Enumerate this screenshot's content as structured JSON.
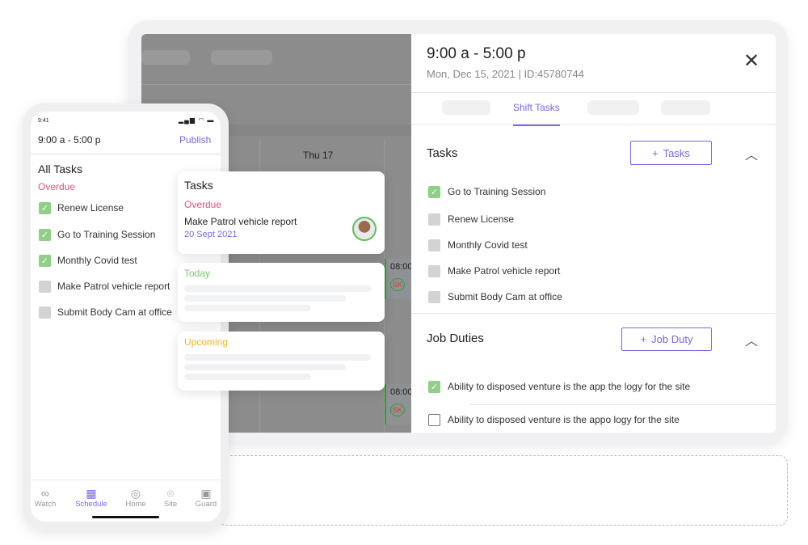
{
  "calendar": {
    "day_header": "Thu 17",
    "shift_time": "08:00",
    "initials": "SK"
  },
  "panel": {
    "title": "9:00 a - 5:00 p",
    "subtitle": "Mon, Dec 15, 2021 | ID:45780744",
    "active_tab": "Shift Tasks",
    "tasks_heading": "Tasks",
    "add_task_label": "Tasks",
    "tasks": [
      {
        "label": "Go to Training Session",
        "checked": true
      },
      {
        "label": "Renew License",
        "checked": false
      },
      {
        "label": "Monthly Covid test",
        "checked": false
      },
      {
        "label": "Make Patrol vehicle report",
        "checked": false
      },
      {
        "label": "Submit Body Cam at office",
        "checked": false
      }
    ],
    "duties_heading": "Job Duties",
    "add_duty_label": "Job Duty",
    "duties": [
      {
        "label": "Ability to disposed venture is the app the logy for the site",
        "checked": true
      },
      {
        "label": "Ability to disposed venture is the appo logy for the site",
        "checked": false
      }
    ]
  },
  "cards": {
    "title": "Tasks",
    "overdue": "Overdue",
    "task": "Make Patrol vehicle report",
    "date": "20 Sept 2021",
    "today": "Today",
    "upcoming": "Upcoming"
  },
  "phone": {
    "clock": "9:41",
    "title": "9:00 a - 5:00 p",
    "publish": "Publish",
    "heading": "All Tasks",
    "overdue": "Overdue",
    "tasks": [
      {
        "label": "Renew License",
        "checked": true
      },
      {
        "label": "Go to Training Session",
        "checked": true
      },
      {
        "label": "Monthly Covid test",
        "checked": true
      },
      {
        "label": "Make Patrol vehicle report",
        "checked": false
      },
      {
        "label": "Submit Body Cam at office",
        "checked": false
      }
    ],
    "nav": [
      {
        "label": "Watch",
        "icon": "binoculars-icon"
      },
      {
        "label": "Schedule",
        "icon": "calendar-icon",
        "active": true
      },
      {
        "label": "Home",
        "icon": "home-icon"
      },
      {
        "label": "Site",
        "icon": "pin-icon"
      },
      {
        "label": "Guard",
        "icon": "guard-icon"
      }
    ]
  },
  "colors": {
    "accent": "#7a68e4",
    "overdue": "#e0517a",
    "today": "#7cc36f",
    "upcoming": "#f2b51f",
    "check": "#8fcf86"
  }
}
